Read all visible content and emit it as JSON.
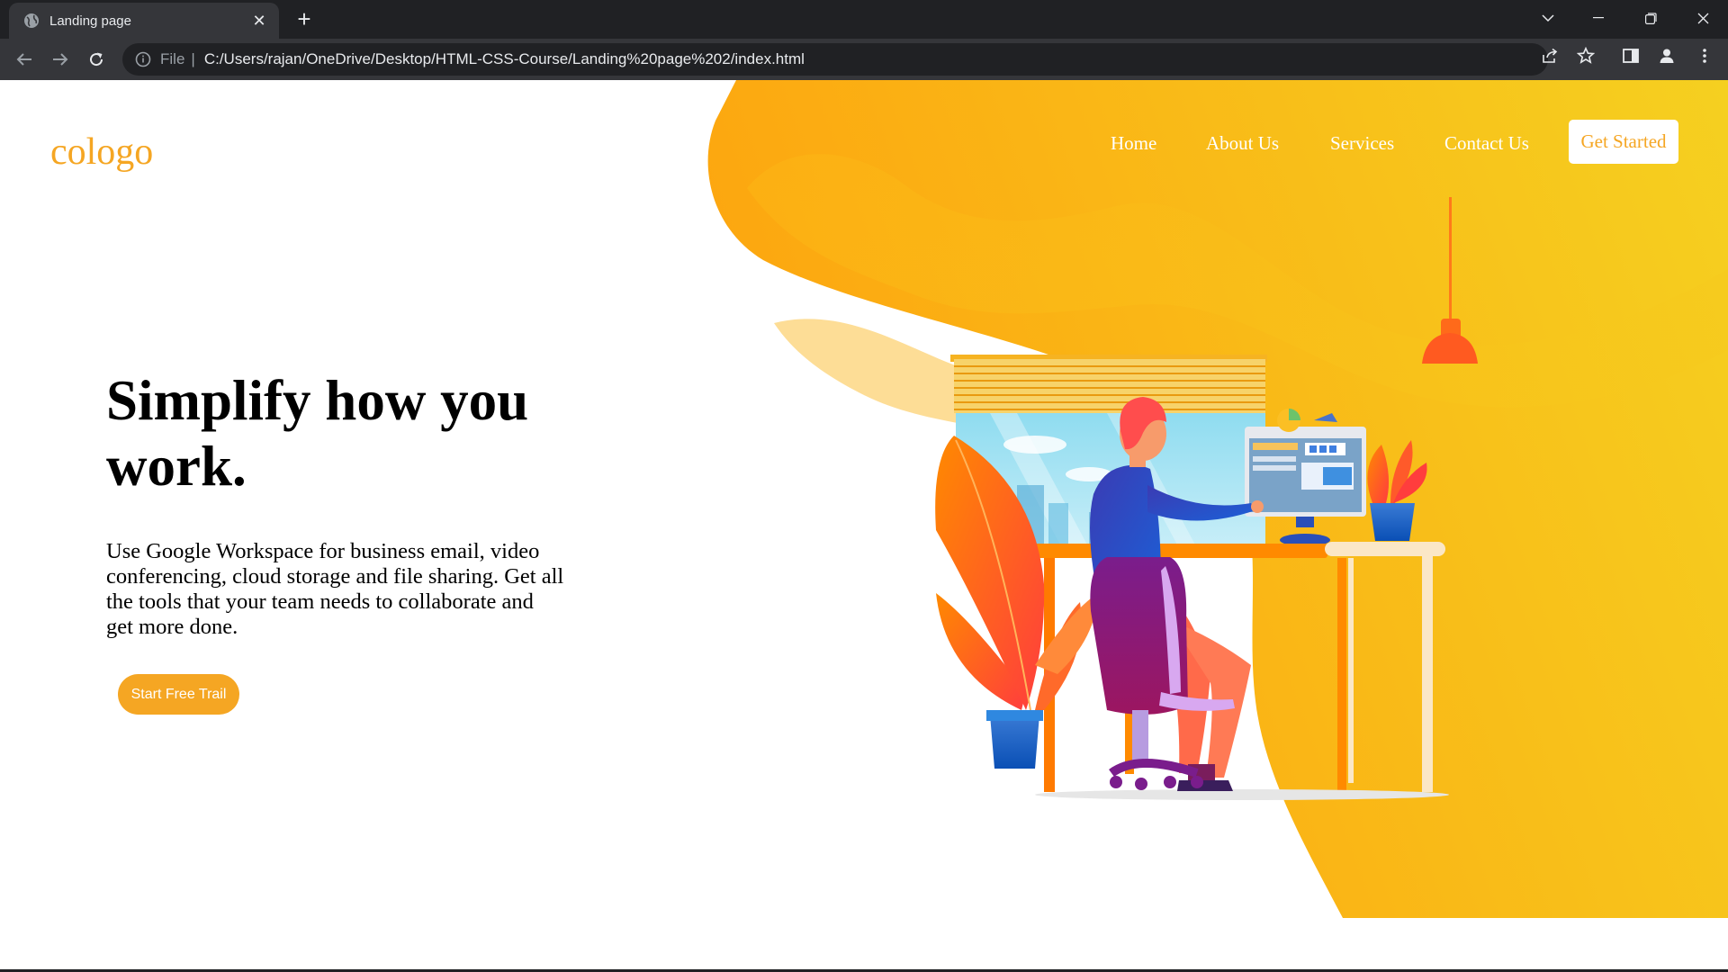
{
  "browser": {
    "tab_title": "Landing page",
    "tab_close": "✕",
    "new_tab": "+",
    "address": {
      "scheme": "File",
      "separator": "|",
      "url": "C:/Users/rajan/OneDrive/Desktop/HTML-CSS-Course/Landing%20page%202/index.html"
    }
  },
  "page": {
    "logo": "cologo",
    "nav": [
      "Home",
      "About Us",
      "Services",
      "Contact Us"
    ],
    "cta_nav": "Get Started",
    "hero_title": "Simplify how you work.",
    "hero_text": "Use Google Workspace for business email, video conferencing, cloud storage and file sharing. Get all the tools that your team needs to collaborate and get more done.",
    "hero_button": "Start Free Trail"
  },
  "colors": {
    "accent": "#f5a623",
    "blob_start": "#fda50f",
    "blob_end": "#f5d020",
    "chrome_dark": "#202124",
    "chrome_tab": "#35363a"
  },
  "icons": [
    "globe-icon",
    "close-icon",
    "plus-icon",
    "chevron-down-icon",
    "minimize-icon",
    "restore-icon",
    "window-close-icon",
    "back-icon",
    "forward-icon",
    "reload-icon",
    "info-icon",
    "share-icon",
    "star-icon",
    "side-panel-icon",
    "profile-icon",
    "menu-icon"
  ]
}
